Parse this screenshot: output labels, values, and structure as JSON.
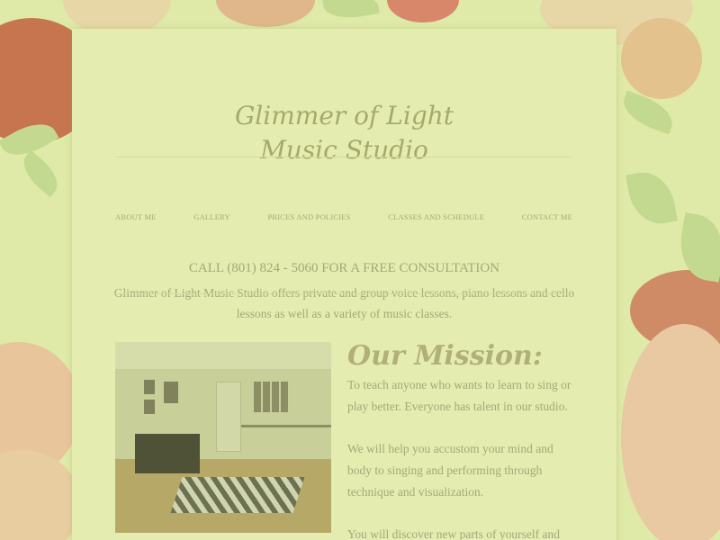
{
  "site": {
    "title_line1": "Glimmer of Light",
    "title_line2": "Music Studio"
  },
  "nav": {
    "items": [
      "ABOUT ME",
      "GALLERY",
      "PRICES AND POLICIES",
      "CLASSES AND SCHEDULE",
      "CONTACT ME"
    ]
  },
  "hero": {
    "cta": "CALL (801) 824 - 5060 FOR A FREE CONSULTATION",
    "intro": "Glimmer of Light Music Studio offers private and group voice lessons, piano lessons and cello lessons as well as a variety of music classes."
  },
  "mission": {
    "heading": "Our Mission:",
    "paragraphs": [
      "To teach anyone who wants to learn to sing or play better. Everyone has talent in our studio.",
      "We will help you accustom your mind and body to singing and performing through technique and visualization.",
      "You will discover new parts of yourself and"
    ]
  },
  "colors": {
    "page_background": "#dfe9a8",
    "panel_background": "#e4ecb0",
    "text": "#a6a877",
    "heading": "#b1b079"
  }
}
